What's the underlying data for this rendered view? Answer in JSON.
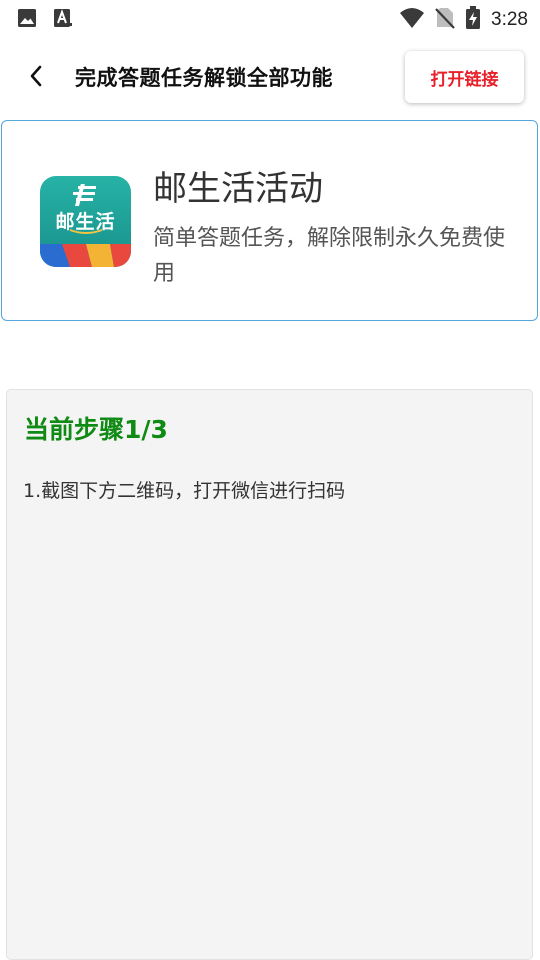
{
  "status_bar": {
    "time": "3:28",
    "icons": [
      "gallery-icon",
      "text-a-icon",
      "wifi-icon",
      "no-sim-icon",
      "battery-charging-icon"
    ]
  },
  "header": {
    "title": "完成答题任务解锁全部功能",
    "open_link_label": "打开链接",
    "back_icon": "chevron-left-icon"
  },
  "app_card": {
    "name": "邮生活活动",
    "description": "简单答题任务，解除限制永久免费使用",
    "icon_text": "邮生活"
  },
  "step": {
    "title": "当前步骤1/3",
    "instruction": "1.截图下方二维码，打开微信进行扫码"
  },
  "colors": {
    "open_link_text": "#e8202a",
    "step_title": "#0f8a13",
    "card_border": "#55a6dc",
    "app_icon_bg": "#1fa79c"
  }
}
